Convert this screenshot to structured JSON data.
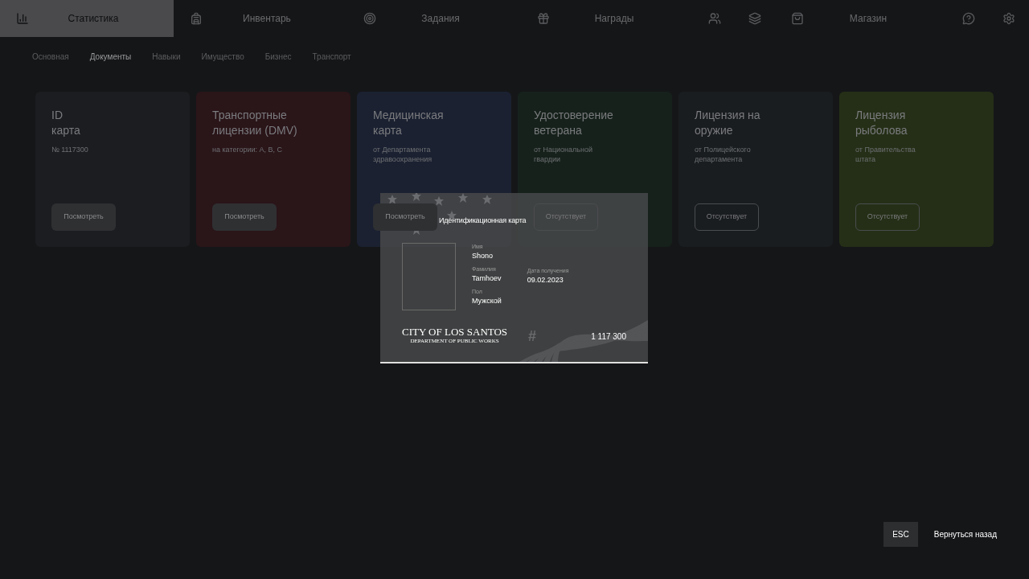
{
  "nav": [
    {
      "label": "Статистика",
      "selected": true
    },
    {
      "label": "Инвентарь",
      "selected": false
    },
    {
      "label": "Задания",
      "selected": false
    },
    {
      "label": "Награды",
      "selected": false
    },
    {
      "selected": false
    },
    {
      "selected": false
    },
    {
      "label": "Магазин",
      "selected": false
    },
    {
      "selected": false
    },
    {
      "selected": false
    }
  ],
  "subtabs": [
    {
      "label": "Основная",
      "selected": false
    },
    {
      "label": "Документы",
      "selected": true
    },
    {
      "label": "Навыки",
      "selected": false
    },
    {
      "label": "Имущество",
      "selected": false
    },
    {
      "label": "Бизнес",
      "selected": false
    },
    {
      "label": "Транспорт",
      "selected": false
    }
  ],
  "cards": [
    {
      "title": "ID\nкарта",
      "subtitle": "№ 1117300",
      "color": "#1b1d20",
      "button": {
        "label": "Посмотреть",
        "kind": "view"
      }
    },
    {
      "title": "Транспортные\nлицензии (DMV)",
      "subtitle": "на категории: A, B, C",
      "color": "#2a1519",
      "button": {
        "label": "Посмотреть",
        "kind": "view"
      }
    },
    {
      "title": "Медицинская\nкарта",
      "subtitle": "от Департамента\nздравоохранения",
      "color": "#1b2131",
      "button": {
        "label": "Посмотреть",
        "kind": "view"
      }
    },
    {
      "title": "Удостоверение\nветерана",
      "subtitle": "от Национальной\nгвардии",
      "color": "#16211b",
      "button": {
        "label": "Отсутствует",
        "kind": "absent"
      }
    },
    {
      "title": "Лицензия на\nоружие",
      "subtitle": "от Полицейского\nдепартамента",
      "color": "#1a1d20",
      "button": {
        "label": "Отсутствует",
        "kind": "absent"
      }
    },
    {
      "title": "Лицензия\nрыболова",
      "subtitle": "от Правительства\nштата",
      "color": "#252f17",
      "button": {
        "label": "Отсутствует",
        "kind": "absent"
      }
    }
  ],
  "id_card": {
    "title": "Идентификационная карта",
    "fields": [
      {
        "label": "Имя",
        "value": "Shono"
      },
      {
        "label": "Фамилия",
        "value": "Tamhoev"
      },
      {
        "label": "Пол",
        "value": "Мужской"
      }
    ],
    "issued": {
      "label": "Дата получения",
      "value": "09.02.2023"
    },
    "city": "CITY OF LOS SANTOS",
    "department": "DEPARTMENT OF PUBLIC WORKS",
    "hash": "#",
    "number": "1 117 300"
  },
  "footer": {
    "key": "ESC",
    "label": "Вернуться назад"
  }
}
